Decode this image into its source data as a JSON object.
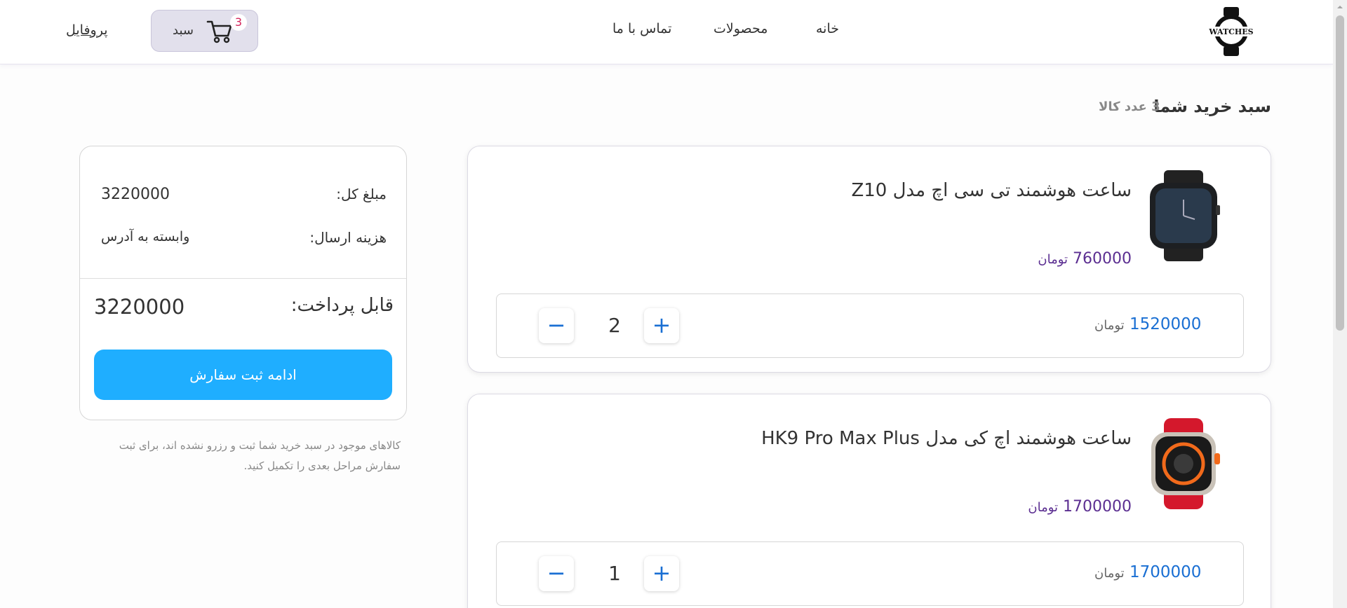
{
  "header": {
    "logo_text": "WATCHES",
    "nav": {
      "home": "خانه",
      "products": "محصولات",
      "contact": "تماس با ما"
    },
    "cart_label": "سبد",
    "cart_count": "3",
    "profile": "پروفایل"
  },
  "cart": {
    "title": "سبد خرید شما",
    "subtitle": "3 عدد کالا",
    "items": [
      {
        "name": "ساعت هوشمند تی سی اچ مدل Z10",
        "unit_price": "760000",
        "currency": "تومان",
        "row_total": "1520000",
        "quantity": "2"
      },
      {
        "name": "ساعت هوشمند اچ کی مدل HK9 Pro Max Plus",
        "unit_price": "1700000",
        "currency": "تومان",
        "row_total": "1700000",
        "quantity": "1"
      }
    ]
  },
  "summary": {
    "total_label": "مبلغ کل:",
    "total_value": "3220000",
    "shipping_label": "هزینه ارسال:",
    "shipping_value": "وابسته به آدرس",
    "payable_label": "قابل پرداخت:",
    "payable_value": "3220000",
    "order_button": "ادامه ثبت سفارش",
    "note": "کالاهای موجود در سبد خرید شما ثبت و رزرو نشده اند، برای ثبت سفارش مراحل بعدی را تکمیل کنید."
  },
  "controls": {
    "plus": "+",
    "minus": "−"
  },
  "colors": {
    "accent_blue": "#1faeff",
    "price_purple": "#5b2e91",
    "total_blue": "#1a6fd3",
    "badge_pink": "#d3245b"
  }
}
